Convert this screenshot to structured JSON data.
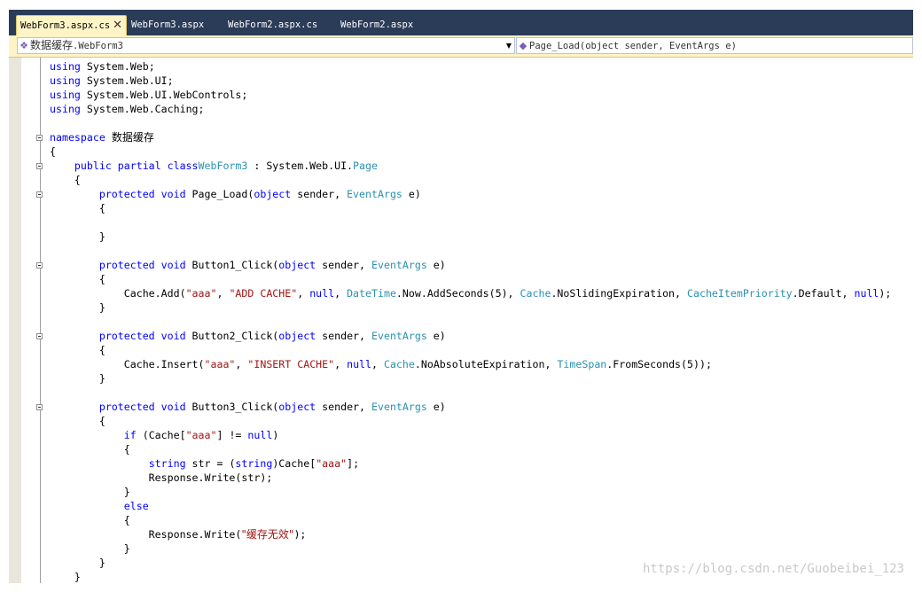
{
  "tabs": [
    {
      "label": "WebForm3.aspx.cs",
      "active": true,
      "close_glyph": "✕"
    },
    {
      "label": "WebForm3.aspx",
      "active": false
    },
    {
      "label": "WebForm2.aspx.cs",
      "active": false
    },
    {
      "label": "WebForm2.aspx",
      "active": false
    }
  ],
  "navbar": {
    "type_dropdown": {
      "icon": "class-icon",
      "value_prefix": "数据缓存",
      "value_suffix": ".WebForm3"
    },
    "member_dropdown": {
      "icon": "method-icon",
      "value": "Page_Load(object sender, EventArgs e)"
    }
  },
  "code_lines": [
    [
      [
        "kw",
        "using"
      ],
      [
        "",
        "System.Web;"
      ]
    ],
    [
      [
        "kw",
        "using"
      ],
      [
        "",
        "System.Web.UI;"
      ]
    ],
    [
      [
        "kw",
        "using"
      ],
      [
        "",
        "System.Web.UI.WebControls;"
      ]
    ],
    [
      [
        "kw",
        "using"
      ],
      [
        "",
        "System.Web.Caching;"
      ]
    ],
    [],
    [
      [
        "kw",
        "namespace"
      ],
      [
        "",
        "数据缓存"
      ]
    ],
    [
      [
        "",
        "{"
      ]
    ],
    [
      [
        "",
        "    "
      ],
      [
        "kw",
        "public partial class"
      ],
      [
        "",
        ""
      ],
      [
        "ty",
        "WebForm3"
      ],
      [
        "",
        " : System.Web.UI."
      ],
      [
        "ty",
        "Page"
      ]
    ],
    [
      [
        "",
        "    {"
      ]
    ],
    [
      [
        "",
        "        "
      ],
      [
        "kw",
        "protected void"
      ],
      [
        "",
        " Page_Load("
      ],
      [
        "kw",
        "object"
      ],
      [
        "",
        " sender, "
      ],
      [
        "ty",
        "EventArgs"
      ],
      [
        "",
        " e)"
      ]
    ],
    [
      [
        "",
        "        {"
      ]
    ],
    [],
    [
      [
        "",
        "        }"
      ]
    ],
    [],
    [
      [
        "",
        "        "
      ],
      [
        "kw",
        "protected void"
      ],
      [
        "",
        " Button1_Click("
      ],
      [
        "kw",
        "object"
      ],
      [
        "",
        " sender, "
      ],
      [
        "ty",
        "EventArgs"
      ],
      [
        "",
        " e)"
      ]
    ],
    [
      [
        "",
        "        {"
      ]
    ],
    [
      [
        "",
        "            Cache.Add("
      ],
      [
        "st",
        "\"aaa\""
      ],
      [
        "",
        ", "
      ],
      [
        "st",
        "\"ADD CACHE\""
      ],
      [
        "",
        ", "
      ],
      [
        "kw",
        "null"
      ],
      [
        "",
        ", "
      ],
      [
        "ty",
        "DateTime"
      ],
      [
        "",
        ".Now.AddSeconds(5), "
      ],
      [
        "ty",
        "Cache"
      ],
      [
        "",
        ".NoSlidingExpiration, "
      ],
      [
        "ty",
        "CacheItemPriority"
      ],
      [
        "",
        ".Default, "
      ],
      [
        "kw",
        "null"
      ],
      [
        "",
        ");"
      ]
    ],
    [
      [
        "",
        "        }"
      ]
    ],
    [],
    [
      [
        "",
        "        "
      ],
      [
        "kw",
        "protected void"
      ],
      [
        "",
        " Button2_Click("
      ],
      [
        "kw",
        "object"
      ],
      [
        "",
        " sender, "
      ],
      [
        "ty",
        "EventArgs"
      ],
      [
        "",
        " e)"
      ]
    ],
    [
      [
        "",
        "        {"
      ]
    ],
    [
      [
        "",
        "            Cache.Insert("
      ],
      [
        "st",
        "\"aaa\""
      ],
      [
        "",
        ", "
      ],
      [
        "st",
        "\"INSERT CACHE\""
      ],
      [
        "",
        ", "
      ],
      [
        "kw",
        "null"
      ],
      [
        "",
        ", "
      ],
      [
        "ty",
        "Cache"
      ],
      [
        "",
        ".NoAbsoluteExpiration, "
      ],
      [
        "ty",
        "TimeSpan"
      ],
      [
        "",
        ".FromSeconds(5));"
      ]
    ],
    [
      [
        "",
        "        }"
      ]
    ],
    [],
    [
      [
        "",
        "        "
      ],
      [
        "kw",
        "protected void"
      ],
      [
        "",
        " Button3_Click("
      ],
      [
        "kw",
        "object"
      ],
      [
        "",
        " sender, "
      ],
      [
        "ty",
        "EventArgs"
      ],
      [
        "",
        " e)"
      ]
    ],
    [
      [
        "",
        "        {"
      ]
    ],
    [
      [
        "",
        "            "
      ],
      [
        "kw",
        "if"
      ],
      [
        "",
        " (Cache["
      ],
      [
        "st",
        "\"aaa\""
      ],
      [
        "",
        "] != "
      ],
      [
        "kw",
        "null"
      ],
      [
        "",
        ")"
      ]
    ],
    [
      [
        "",
        "            {"
      ]
    ],
    [
      [
        "",
        "                "
      ],
      [
        "kw",
        "string"
      ],
      [
        "",
        " str = ("
      ],
      [
        "kw",
        "string"
      ],
      [
        "",
        ")Cache["
      ],
      [
        "st",
        "\"aaa\""
      ],
      [
        "",
        "];"
      ]
    ],
    [
      [
        "",
        "                Response.Write(str);"
      ]
    ],
    [
      [
        "",
        "            }"
      ]
    ],
    [
      [
        "",
        "            "
      ],
      [
        "kw",
        "else"
      ]
    ],
    [
      [
        "",
        "            {"
      ]
    ],
    [
      [
        "",
        "                Response.Write("
      ],
      [
        "st",
        "\"缓存无效\""
      ],
      [
        "",
        ");"
      ]
    ],
    [
      [
        "",
        "            }"
      ]
    ],
    [
      [
        "",
        "        }"
      ]
    ],
    [
      [
        "",
        "    }"
      ]
    ]
  ],
  "watermark": "https://blog.csdn.net/Guobeibei_123"
}
